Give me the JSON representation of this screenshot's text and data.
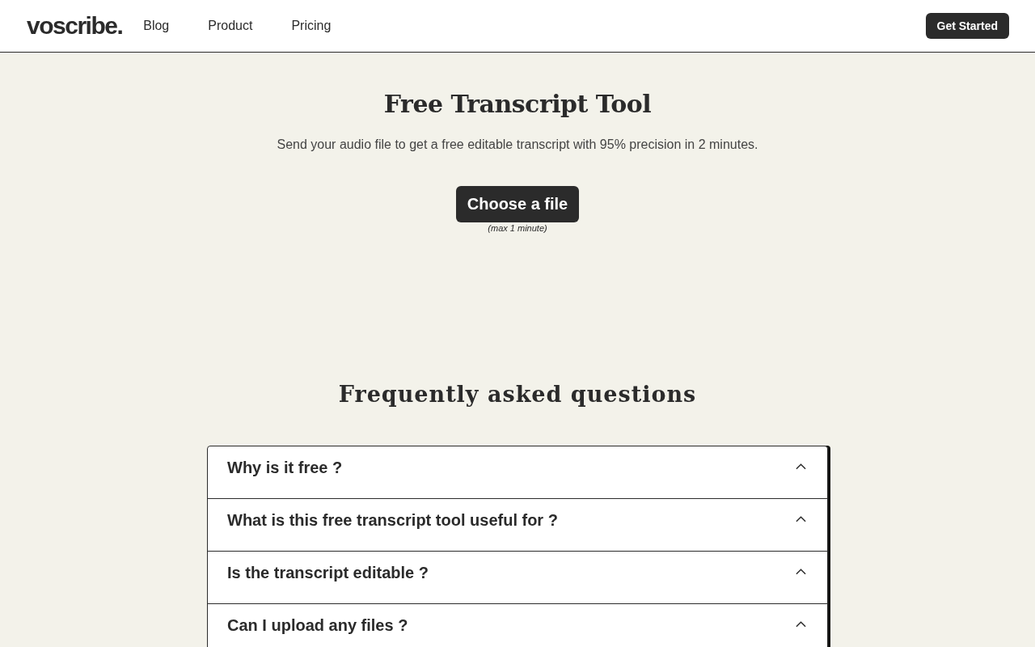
{
  "header": {
    "logo": "voscribe.",
    "nav": [
      {
        "label": "Blog"
      },
      {
        "label": "Product"
      },
      {
        "label": "Pricing"
      }
    ],
    "cta": "Get Started"
  },
  "hero": {
    "title": "Free Transcript Tool",
    "subtitle": "Send your audio file to get a free editable transcript with 95% precision in 2 minutes.",
    "button": "Choose a file",
    "note": "(max 1 minute)"
  },
  "faq": {
    "title": "Frequently asked questions",
    "items": [
      {
        "question": "Why is it free ?",
        "expanded": false
      },
      {
        "question": "What is this free transcript tool useful for ?",
        "expanded": false
      },
      {
        "question": "Is the transcript editable ?",
        "expanded": false
      },
      {
        "question": "Can I upload any files ?",
        "expanded": false
      }
    ]
  }
}
